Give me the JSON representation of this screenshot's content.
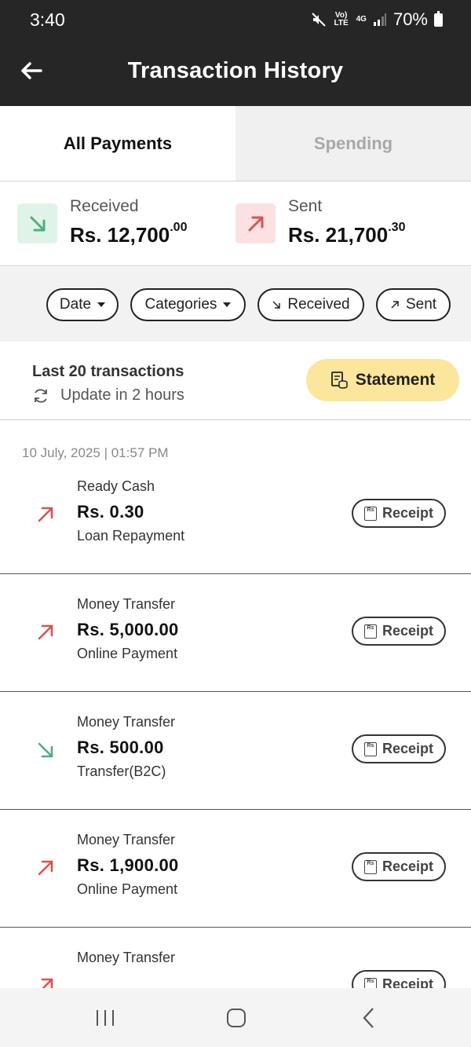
{
  "status_bar": {
    "time": "3:40",
    "network": "4G",
    "volte": "Vo) LTE",
    "battery": "70%"
  },
  "header": {
    "title": "Transaction History"
  },
  "tabs": [
    {
      "label": "All Payments",
      "active": true
    },
    {
      "label": "Spending",
      "active": false
    }
  ],
  "summary": {
    "received": {
      "label": "Received",
      "amount": "Rs. 12,700",
      "decimals": ".00",
      "color": "#e0f3e8"
    },
    "sent": {
      "label": "Sent",
      "amount": "Rs. 21,700",
      "decimals": ".30",
      "color": "#fbe1e1"
    }
  },
  "filters": {
    "date": "Date",
    "categories": "Categories",
    "received": "Received",
    "sent": "Sent"
  },
  "statement_bar": {
    "count": "Last 20 transactions",
    "update": "Update in 2 hours",
    "button": "Statement"
  },
  "date_header": "10 July, 2025 | 01:57 PM",
  "transactions": [
    {
      "category": "Ready Cash",
      "amount": "Rs. 0.30",
      "description": "Loan Repayment",
      "direction": "sent",
      "receipt": "Receipt"
    },
    {
      "category": "Money Transfer",
      "amount": "Rs. 5,000.00",
      "description": "Online Payment",
      "direction": "sent",
      "receipt": "Receipt"
    },
    {
      "category": "Money Transfer",
      "amount": "Rs. 500.00",
      "description": "Transfer(B2C)",
      "direction": "received",
      "receipt": "Receipt"
    },
    {
      "category": "Money Transfer",
      "amount": "Rs. 1,900.00",
      "description": "Online Payment",
      "direction": "sent",
      "receipt": "Receipt"
    },
    {
      "category": "Money Transfer",
      "amount": "",
      "description": "",
      "direction": "sent",
      "receipt": "Receipt"
    }
  ],
  "colors": {
    "sent_arrow": "#d9534f",
    "received_arrow": "#4caf7d",
    "accent": "#fbe69c"
  }
}
